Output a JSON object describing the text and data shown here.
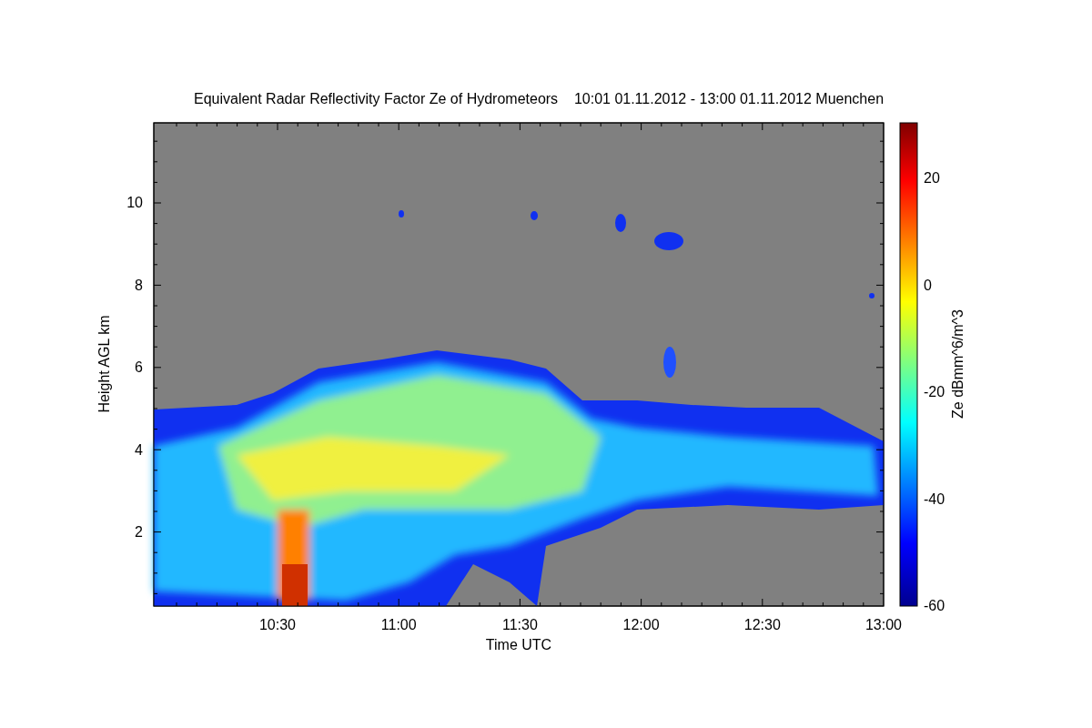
{
  "title": "Equivalent Radar Reflectivity Factor Ze of Hydrometeors    10:01 01.11.2012 - 13:00 01.11.2012 Muenchen",
  "plot": {
    "xlabel": "Time UTC",
    "ylabel": "Height AGL km",
    "xticks": [
      "10:30",
      "11:00",
      "11:30",
      "12:00",
      "12:30",
      "13:00"
    ],
    "yticks": [
      "10",
      "8",
      "6",
      "4",
      "2"
    ]
  },
  "colorbar": {
    "label": "Ze dBmm^6/m^3",
    "ticks": [
      "20",
      "0",
      "-20",
      "-40",
      "-60"
    ]
  }
}
